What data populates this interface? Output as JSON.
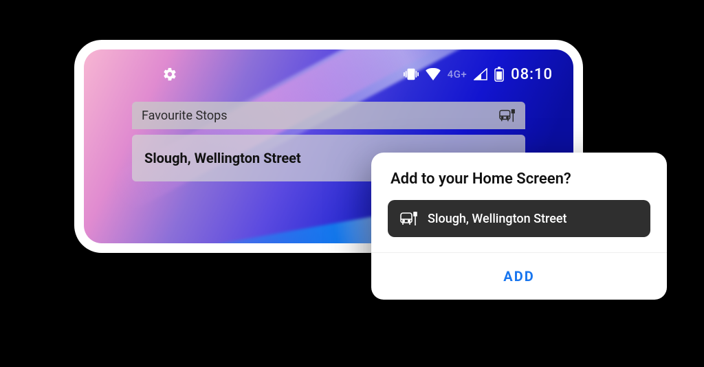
{
  "status": {
    "network_label": "4G+",
    "time": "08:10"
  },
  "widget": {
    "header": "Favourite Stops",
    "item": "Slough, Wellington Street"
  },
  "dialog": {
    "title": "Add to your Home Screen?",
    "chip_label": "Slough, Wellington Street",
    "action": "ADD"
  }
}
